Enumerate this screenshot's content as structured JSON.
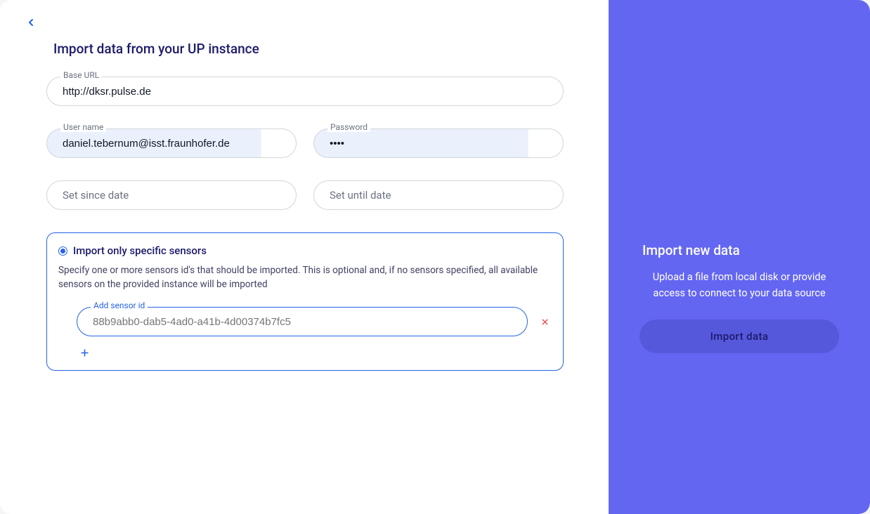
{
  "page": {
    "title": "Import data from your UP instance"
  },
  "fields": {
    "base_url": {
      "label": "Base URL",
      "value": "http://dksr.pulse.de"
    },
    "username": {
      "label": "User name",
      "value": "daniel.tebernum@isst.fraunhofer.de"
    },
    "password": {
      "label": "Password",
      "value": "••••"
    },
    "since": {
      "placeholder": "Set since date"
    },
    "until": {
      "placeholder": "Set until date"
    }
  },
  "sensors": {
    "title": "Import only specific sensors",
    "description": "Specify one or more sensors id's that should be imported. This is optional and, if no sensors specified, all available sensors on the provided instance will be imported",
    "add_label": "Add sensor id",
    "items": [
      {
        "placeholder": "88b9abb0-dab5-4ad0-a41b-4d00374b7fc5"
      }
    ]
  },
  "sidebar": {
    "title": "Import new data",
    "description": "Upload a file from local disk or provide access to connect to your data source",
    "button": "Import data"
  }
}
